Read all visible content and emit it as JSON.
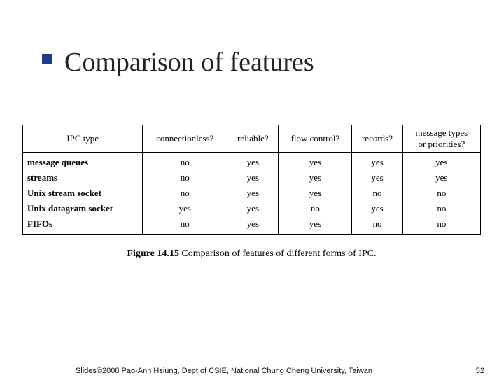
{
  "title": "Comparison of features",
  "table": {
    "headers": [
      "IPC type",
      "connectionless?",
      "reliable?",
      "flow control?",
      "records?",
      "message types\nor priorities?"
    ],
    "rows": [
      {
        "label": "message queues",
        "cells": [
          "no",
          "yes",
          "yes",
          "yes",
          "yes"
        ]
      },
      {
        "label": "streams",
        "cells": [
          "no",
          "yes",
          "yes",
          "yes",
          "yes"
        ]
      },
      {
        "label": "Unix stream socket",
        "cells": [
          "no",
          "yes",
          "yes",
          "no",
          "no"
        ]
      },
      {
        "label": "Unix datagram socket",
        "cells": [
          "yes",
          "yes",
          "no",
          "yes",
          "no"
        ]
      },
      {
        "label": "FIFOs",
        "cells": [
          "no",
          "yes",
          "yes",
          "no",
          "no"
        ]
      }
    ]
  },
  "caption_prefix": "Figure 14.15",
  "caption_rest": "   Comparison of features of different forms of IPC.",
  "footer": "Slides©2008 Pao-Ann Hsiung, Dept of CSIE, National Chung Cheng University, Taiwan",
  "page": "52"
}
